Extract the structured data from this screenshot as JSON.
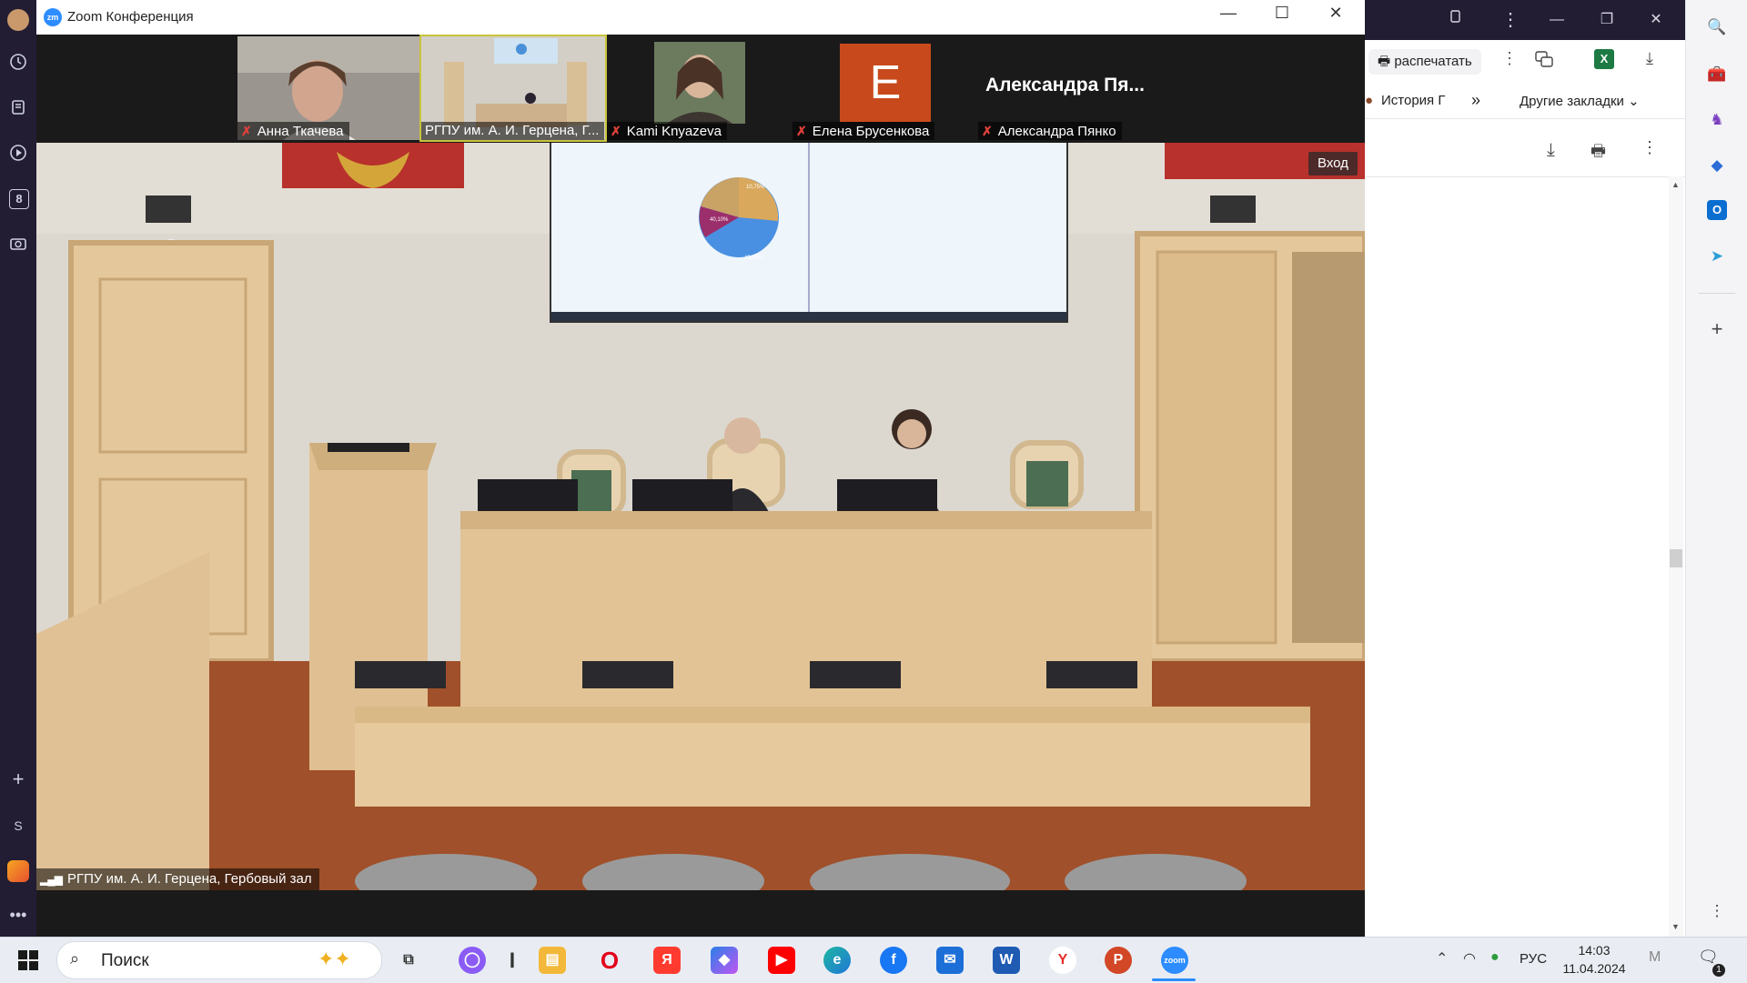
{
  "zoom": {
    "title": "Zoom Конференция",
    "logo": "zm",
    "login_label": "Вход",
    "participants": [
      {
        "name": "Анна Ткачева",
        "muted": true
      },
      {
        "name": "РГПУ им. А. И. Герцена, Г...",
        "muted": false
      },
      {
        "name": "Kami Knyazeva",
        "muted": true
      },
      {
        "name": "Елена Брусенкова",
        "muted": true,
        "avatar_letter": "E",
        "avatar_color": "#c84a1c"
      },
      {
        "name": "Александра Пянко",
        "muted": true,
        "display_label": "Александра Пя..."
      }
    ],
    "main_video_label": "РГПУ им. А. И. Герцена, Гербовый зал",
    "slide_pie_labels": [
      "49,15%",
      "40,10%",
      "10,75%"
    ]
  },
  "browser": {
    "print_label": "распечатать",
    "history_label": "История Г",
    "other_bookmarks_label": "Другие закладки",
    "more_glyph": "»"
  },
  "taskbar": {
    "search_placeholder": "Поиск",
    "language": "РУС",
    "time": "14:03",
    "date": "11.04.2024",
    "notification_count": "1"
  },
  "left_sidebar_badge": "8",
  "left_sidebar_letter": "S"
}
